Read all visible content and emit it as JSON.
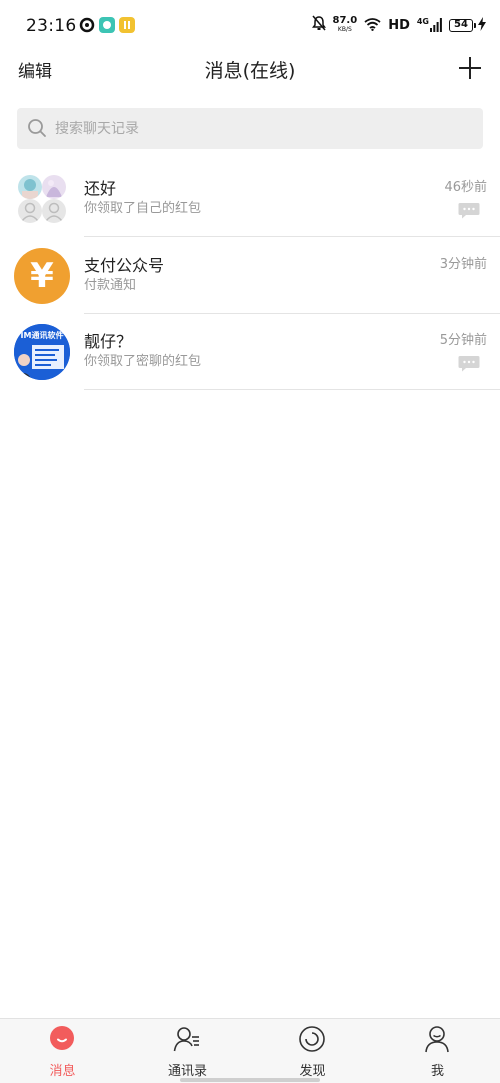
{
  "status_bar": {
    "time": "23:16",
    "net_speed_value": "87.0",
    "net_speed_unit": "KB/S",
    "hd": "HD",
    "signal": "4G",
    "battery": "54"
  },
  "header": {
    "edit_label": "编辑",
    "title": "消息(在线)",
    "add_icon": "plus-icon"
  },
  "search": {
    "placeholder": "搜索聊天记录"
  },
  "chats": [
    {
      "name": "还好",
      "preview": "你领取了自己的红包",
      "time": "46秒前",
      "avatar": "group-avatar",
      "has_msg_icon": true
    },
    {
      "name": "支付公众号",
      "preview": "付款通知",
      "time": "3分钟前",
      "avatar": "payment-avatar",
      "avatar_glyph": "¥",
      "has_msg_icon": false
    },
    {
      "name": "靓仔？",
      "preview": "你领取了密聊的红包",
      "time": "5分钟前",
      "avatar": "promo-avatar",
      "avatar_text": "IM通讯软件",
      "has_msg_icon": true
    }
  ],
  "bottom_nav": [
    {
      "label": "消息",
      "icon": "message-bubble-icon",
      "active": true
    },
    {
      "label": "通讯录",
      "icon": "contacts-icon",
      "active": false
    },
    {
      "label": "发现",
      "icon": "discover-icon",
      "active": false
    },
    {
      "label": "我",
      "icon": "profile-icon",
      "active": false
    }
  ],
  "colors": {
    "accent": "#f25c5c",
    "payment_avatar": "#f0a030",
    "search_bg": "#eeeeee",
    "nav_bg": "#f7f7f7"
  }
}
